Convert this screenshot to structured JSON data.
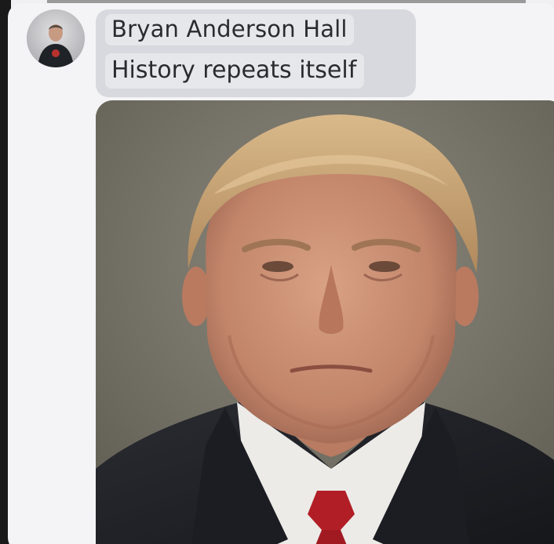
{
  "post": {
    "author_name": "Bryan Anderson Hall",
    "message": "History repeats itself"
  },
  "avatar": {
    "icon": "profile-photo"
  },
  "attachment": {
    "icon": "portrait-photo"
  },
  "colors": {
    "bubble_bg": "#d8d9de",
    "chip_bg": "#e6e7eb",
    "text": "#2a2b30",
    "card_bg": "#f4f4f6"
  }
}
